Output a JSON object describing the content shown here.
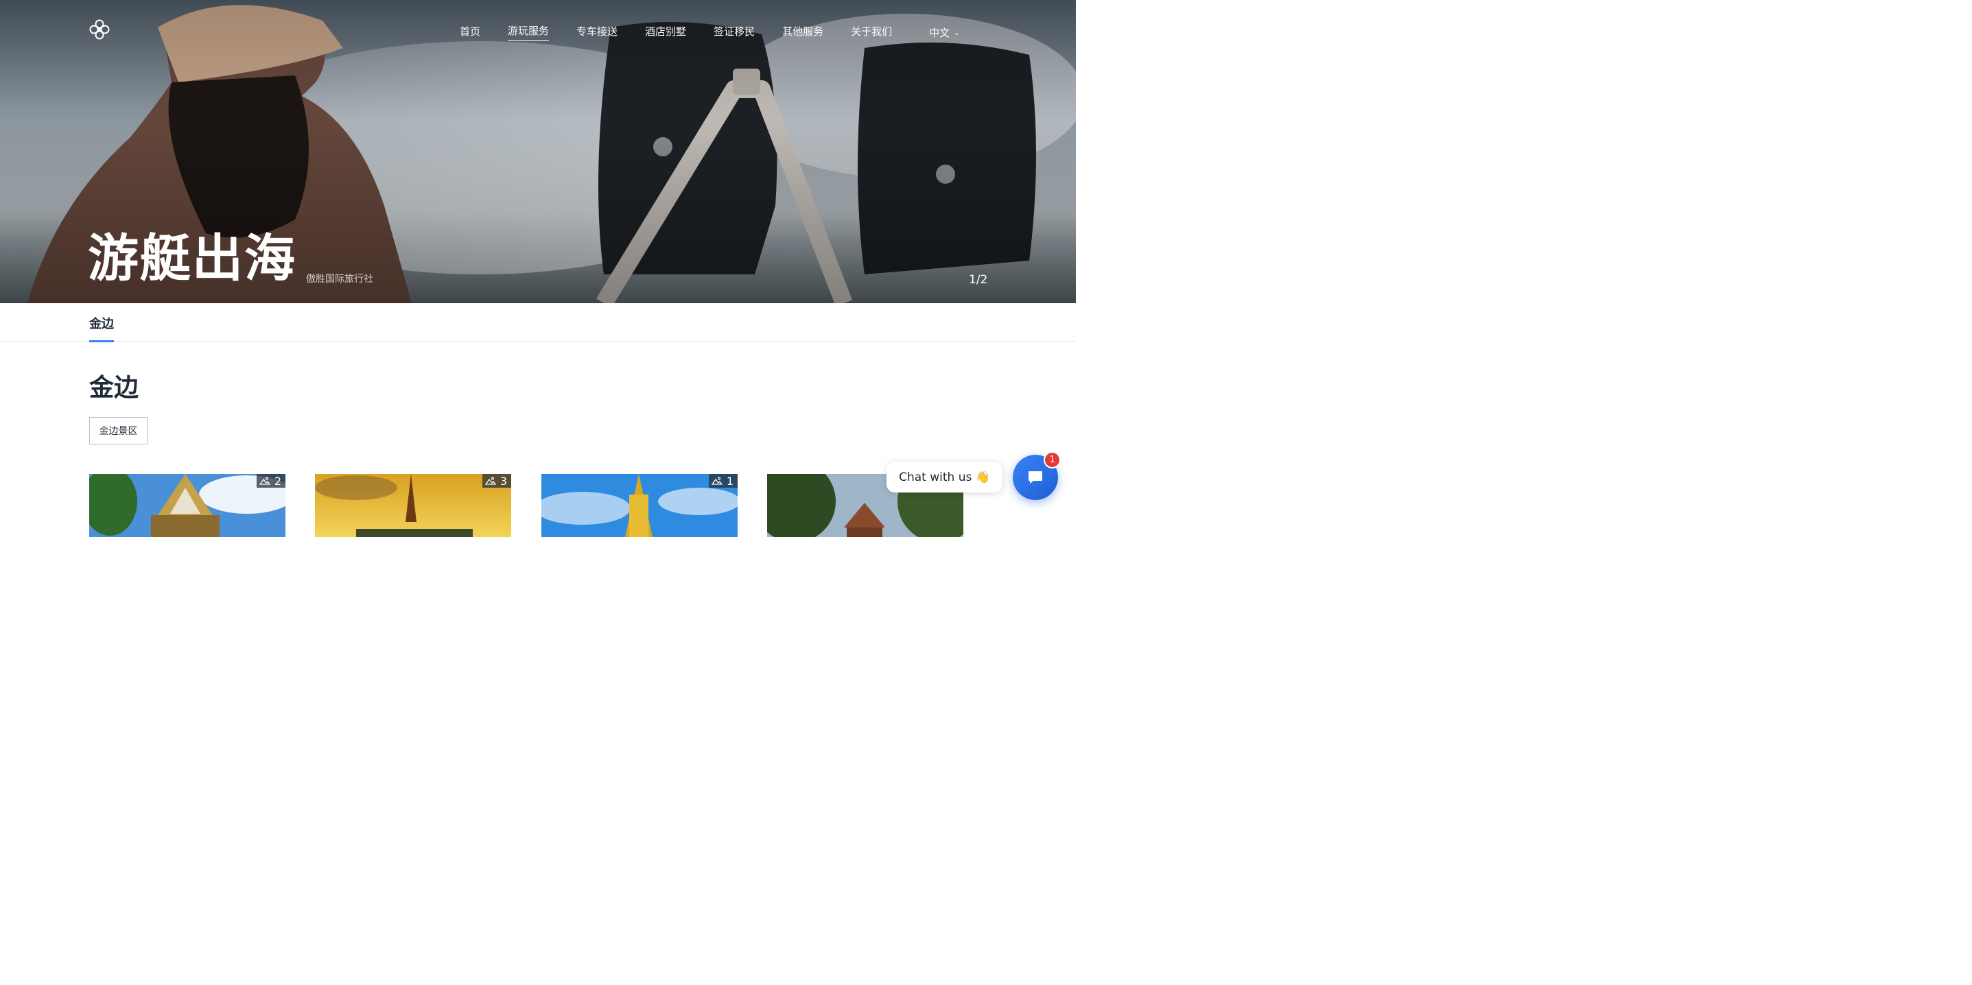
{
  "header": {
    "nav": [
      {
        "label": "首页",
        "active": false
      },
      {
        "label": "游玩服务",
        "active": true
      },
      {
        "label": "专车接送",
        "active": false
      },
      {
        "label": "酒店别墅",
        "active": false
      },
      {
        "label": "签证移民",
        "active": false
      },
      {
        "label": "其他服务",
        "active": false
      },
      {
        "label": "关于我们",
        "active": false
      }
    ],
    "language": "中文",
    "logo_icon": "lotus-logo-icon"
  },
  "hero": {
    "title": "游艇出海",
    "subtitle": "傲胜国际旅行社",
    "counter": "1/2"
  },
  "tabs": [
    {
      "label": "金边",
      "active": true
    }
  ],
  "section": {
    "title": "金边",
    "filter_chip": "金边景区"
  },
  "cards": [
    {
      "photo_count": "2"
    },
    {
      "photo_count": "3"
    },
    {
      "photo_count": "1"
    },
    {
      "photo_count": ""
    }
  ],
  "chat": {
    "bubble_text": "Chat with us 👋",
    "unread_count": "1"
  },
  "colors": {
    "accent": "#3b82f6",
    "badge_red": "#e53935",
    "text_dark": "#1f2a37"
  }
}
